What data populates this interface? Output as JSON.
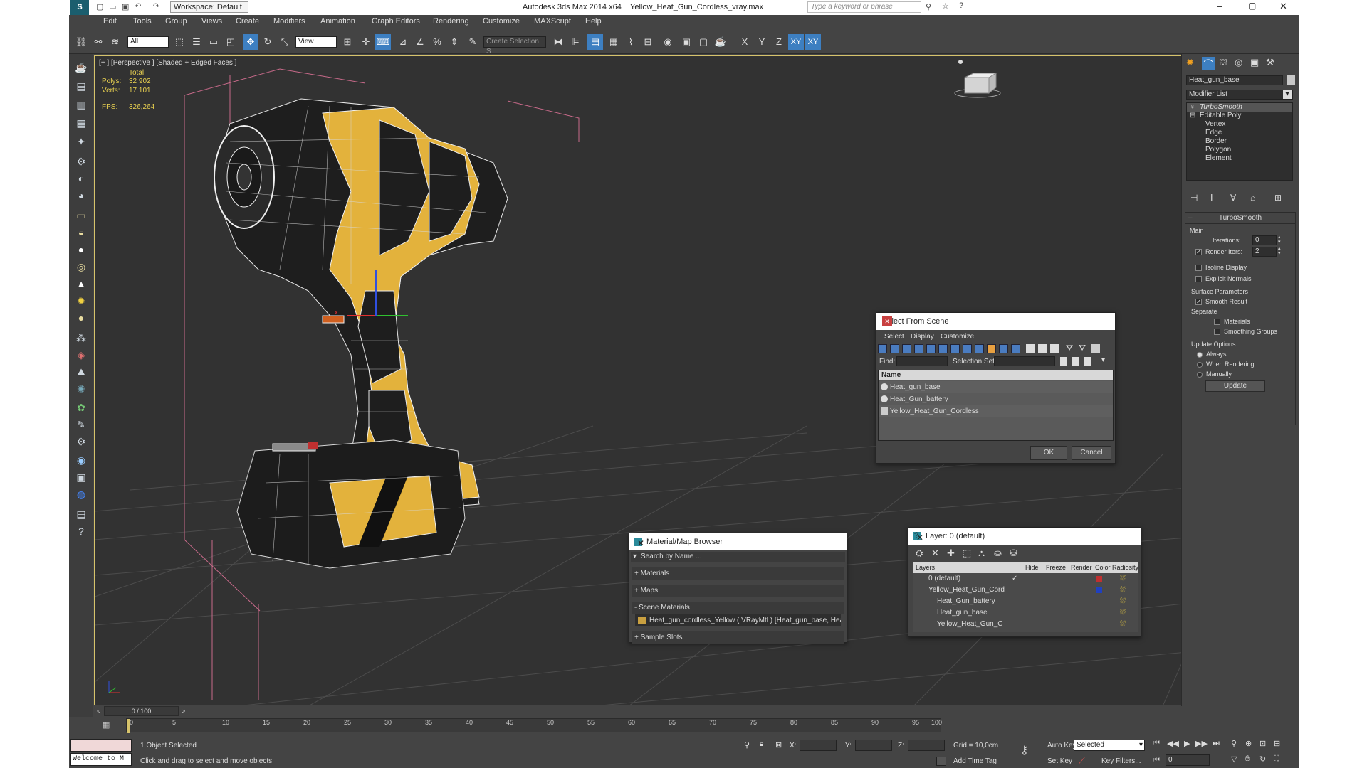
{
  "app": {
    "title": "Autodesk 3ds Max  2014 x64",
    "file": "Yellow_Heat_Gun_Cordless_vray.max",
    "workspace": "Workspace: Default",
    "search_placeholder": "Type a keyword or phrase"
  },
  "menu": [
    "Edit",
    "Tools",
    "Group",
    "Views",
    "Create",
    "Modifiers",
    "Animation",
    "Graph Editors",
    "Rendering",
    "Customize",
    "MAXScript",
    "Help"
  ],
  "toolbar": {
    "filter": "All",
    "ref_coord": "View",
    "selection_set_placeholder": "Create Selection S"
  },
  "viewport": {
    "label": "[+ ] [Perspective ] [Shaded + Edged Faces ]",
    "stats": {
      "total_label": "Total",
      "polys_label": "Polys:",
      "polys": "32 902",
      "verts_label": "Verts:",
      "verts": "17 101",
      "fps_label": "FPS:",
      "fps": "326,264"
    },
    "colors": {
      "yellow": "#e3b23c",
      "dark": "#1e1e1e",
      "grid": "#4a4a4a",
      "selection": "#c86a8a"
    }
  },
  "command_panel": {
    "object_name": "Heat_gun_base",
    "modifier_list": "Modifier List",
    "stack": [
      "TurboSmooth",
      "Editable Poly",
      "Vertex",
      "Edge",
      "Border",
      "Polygon",
      "Element"
    ],
    "turbosmooth": {
      "title": "TurboSmooth",
      "main": "Main",
      "iterations_label": "Iterations:",
      "iterations": "0",
      "render_iters_label": "Render Iters:",
      "render_iters": "2",
      "isoline": "Isoline Display",
      "explicit": "Explicit Normals",
      "surface_params": "Surface Parameters",
      "smooth_result": "Smooth Result",
      "separate": "Separate",
      "materials": "Materials",
      "smoothing_groups": "Smoothing Groups",
      "update_options": "Update Options",
      "always": "Always",
      "when_rendering": "When Rendering",
      "manually": "Manually",
      "update": "Update"
    }
  },
  "select_dialog": {
    "title": "Select From Scene",
    "menu": [
      "Select",
      "Display",
      "Customize"
    ],
    "find_label": "Find:",
    "selset_label": "Selection Set:",
    "col_name": "Name",
    "items": [
      "Heat_gun_base",
      "Heat_Gun_battery",
      "Yellow_Heat_Gun_Cordless"
    ],
    "ok": "OK",
    "cancel": "Cancel"
  },
  "material_browser": {
    "title": "Material/Map Browser",
    "search": "Search by Name ...",
    "groups": [
      "+ Materials",
      "+ Maps",
      "- Scene Materials",
      "+ Sample Slots"
    ],
    "scene_material": "Heat_gun_cordless_Yellow  ( VRayMtl ) [Heat_gun_base, Heat_Gun..."
  },
  "layer_dialog": {
    "title": "Layer: 0 (default)",
    "help": "?",
    "cols": [
      "Layers",
      "Hide",
      "Freeze",
      "Render",
      "Color",
      "Radiosity"
    ],
    "rows": [
      "0 (default)",
      "Yellow_Heat_Gun_Cord",
      "Heat_Gun_battery",
      "Heat_gun_base",
      "Yellow_Heat_Gun_C"
    ],
    "row_colors": [
      "#c03030",
      "#2040c0",
      "#3a3a3a",
      "#3a3a3a",
      "#3a3a3a"
    ]
  },
  "timeline": {
    "frame": "0 / 100",
    "ticks": [
      "0",
      "5",
      "10",
      "15",
      "20",
      "25",
      "30",
      "35",
      "40",
      "45",
      "50",
      "55",
      "60",
      "65",
      "70",
      "75",
      "80",
      "85",
      "90",
      "95",
      "100"
    ]
  },
  "status": {
    "script": "Welcome to M",
    "selected": "1 Object Selected",
    "prompt": "Click and drag to select and move objects",
    "x_label": "X:",
    "y_label": "Y:",
    "z_label": "Z:",
    "grid": "Grid = 10,0cm",
    "add_time_tag": "Add Time Tag",
    "auto_key": "Auto Key",
    "set_key": "Set Key",
    "key_mode": "Selected",
    "key_filters": "Key Filters...",
    "frame": "0"
  }
}
